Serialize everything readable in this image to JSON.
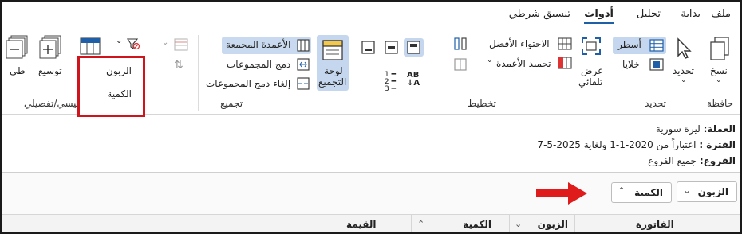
{
  "menu": {
    "tabs": [
      "ملف",
      "بداية",
      "تحليل",
      "أدوات",
      "تنسيق شرطي"
    ],
    "active_tab": "أدوات"
  },
  "ribbon": {
    "clipboard": {
      "label": "حافظة",
      "copy": "نسخ"
    },
    "selection": {
      "label": "تحديد",
      "select": "تحديد",
      "rows": "أسطر",
      "cells": "خلايا"
    },
    "layout": {
      "label": "تخطيط",
      "auto_view_line1": "عرض",
      "auto_view_line2": "تلقائي",
      "best_fit": "الاحتواء الأفضل",
      "freeze_columns": "تجميد الأعمدة"
    },
    "grouping": {
      "label": "تجميع",
      "group_panel_line1": "لوحة",
      "group_panel_line2": "التجميع",
      "grouped_columns": "الأعمدة المجمعة",
      "merge_groups": "دمج المجموعات",
      "unmerge_groups": "إلغاء دمج المجموعات"
    },
    "summary": {
      "label_visible": "رئيسي/تفصيلي",
      "expand": "توسيع",
      "collapse_partial": "طي",
      "partial_label": "ت"
    }
  },
  "popup": {
    "items": [
      "الزبون",
      "الكمية"
    ]
  },
  "info": {
    "currency_key": "العملة:",
    "currency_val": "ليرة سورية",
    "period_key": "الفترة :",
    "period_val": "اعتباراً من 2020-1-1 ولغاية 2025-5-7",
    "branches_key": "الفروع:",
    "branches_val": "جميع الفروع"
  },
  "group_chips": [
    "الزبون",
    "الكمية"
  ],
  "columns": [
    "الفاتورة",
    "الزبون",
    "الكمية",
    "القيمة"
  ],
  "colors": {
    "accent": "#1f5fa8",
    "highlight": "#c5d7ee",
    "popup_border": "#d0141c",
    "arrow": "#e01b1b"
  }
}
